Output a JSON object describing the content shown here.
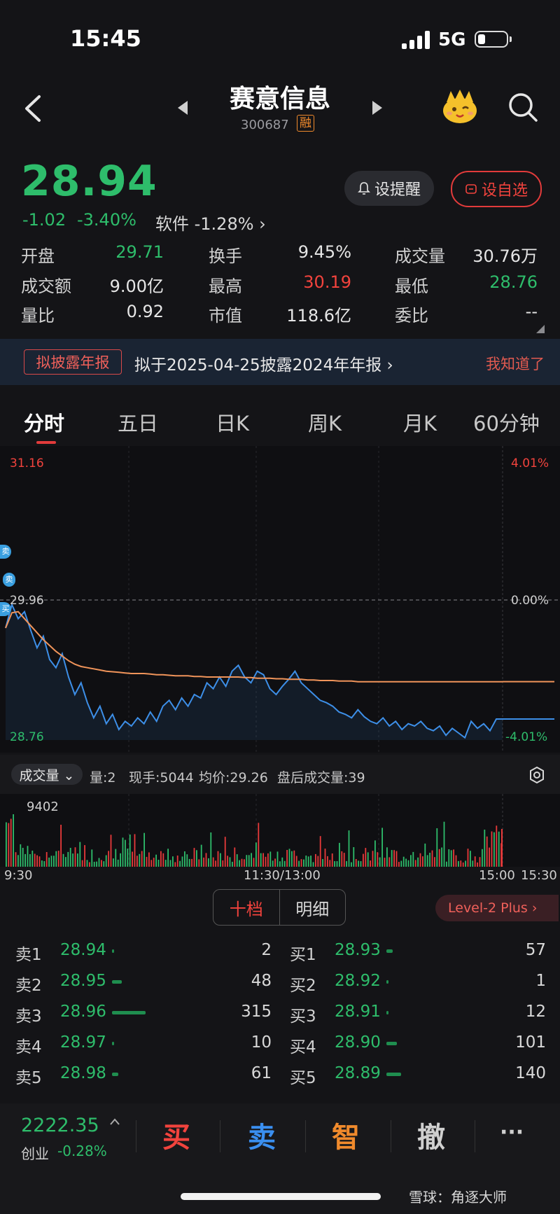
{
  "status_bar": {
    "time": "15:45",
    "network": "5G"
  },
  "header": {
    "title": "赛意信息",
    "code": "300687",
    "margin_badge": "融"
  },
  "quote": {
    "price": "28.94",
    "change": "-1.02",
    "change_pct": "-3.40%",
    "sector": "软件 -1.28%  ›",
    "remind_label": "设提醒",
    "watch_label": "设自选",
    "stats": [
      {
        "label": "开盘",
        "value": "29.71",
        "color": "green"
      },
      {
        "label": "换手",
        "value": "9.45%",
        "color": "white"
      },
      {
        "label": "成交量",
        "value": "30.76万",
        "color": "white"
      },
      {
        "label": "成交额",
        "value": "9.00亿",
        "color": "white"
      },
      {
        "label": "最高",
        "value": "30.19",
        "color": "red"
      },
      {
        "label": "最低",
        "value": "28.76",
        "color": "green"
      },
      {
        "label": "量比",
        "value": "0.92",
        "color": "white"
      },
      {
        "label": "市值",
        "value": "118.6亿",
        "color": "white"
      },
      {
        "label": "委比",
        "value": "--",
        "color": "white"
      }
    ]
  },
  "banner": {
    "tag": "拟披露年报",
    "text": "拟于2025-04-25披露2024年年报  ›",
    "dismiss": "我知道了"
  },
  "tabs": [
    {
      "label": "分时",
      "active": true
    },
    {
      "label": "五日"
    },
    {
      "label": "日K"
    },
    {
      "label": "周K"
    },
    {
      "label": "月K"
    },
    {
      "label": "60分钟 ⌄"
    }
  ],
  "chart": {
    "y_high": "31.16",
    "y_mid": "29.96",
    "y_low": "28.76",
    "pct_high": "4.01%",
    "pct_mid": "0.00%",
    "pct_low": "-4.01%",
    "markers": [
      "卖",
      "卖",
      "买"
    ],
    "colors": {
      "price": "#3d8fe8",
      "avg": "#f0945a",
      "up": "#e83a3a",
      "down": "#2ebd6b"
    }
  },
  "chart_data": {
    "type": "line",
    "ylim": [
      28.76,
      31.16
    ],
    "series": [
      {
        "values": [
          29.72,
          29.92,
          29.8,
          29.86,
          29.7,
          29.55,
          29.65,
          29.45,
          29.38,
          29.5,
          29.3,
          29.15,
          29.25,
          29.08,
          28.95,
          29.05,
          28.9,
          28.98,
          28.85,
          28.92,
          28.88,
          28.95,
          28.9,
          29.0,
          28.92,
          29.05,
          29.1,
          29.02,
          29.12,
          29.05,
          29.15,
          29.12,
          29.25,
          29.2,
          29.3,
          29.22,
          29.35,
          29.4,
          29.3,
          29.25,
          29.35,
          29.32,
          29.2,
          29.15,
          29.22,
          29.28,
          29.35,
          29.25,
          29.2,
          29.15,
          29.1,
          29.08,
          29.05,
          29.0,
          28.98,
          28.95,
          29.02,
          28.96,
          28.92,
          28.9,
          28.95,
          28.88,
          28.92,
          28.85,
          28.9,
          28.88,
          28.92,
          28.86,
          28.84,
          28.88,
          28.8,
          28.86,
          28.82,
          28.78,
          28.92,
          28.86,
          28.9,
          28.84,
          28.94,
          28.94
        ]
      },
      {
        "values": [
          29.72,
          29.85,
          29.86,
          29.8,
          29.74,
          29.68,
          29.62,
          29.57,
          29.52,
          29.48,
          29.44,
          29.41,
          29.39,
          29.38,
          29.37,
          29.36,
          29.35,
          29.345,
          29.34,
          29.335,
          29.33,
          29.33,
          29.33,
          29.325,
          29.32,
          29.32,
          29.315,
          29.31,
          29.31,
          29.31,
          29.305,
          29.305,
          29.3,
          29.3,
          29.3,
          29.3,
          29.3,
          29.3,
          29.295,
          29.295,
          29.29,
          29.29,
          29.29,
          29.285,
          29.285,
          29.28,
          29.28,
          29.28,
          29.275,
          29.275,
          29.27,
          29.27,
          29.27,
          29.265,
          29.265,
          29.265,
          29.26,
          29.26,
          29.26,
          29.26,
          29.26,
          29.26,
          29.26,
          29.26,
          29.26,
          29.26,
          29.26,
          29.26,
          29.26,
          29.26,
          29.26,
          29.26,
          29.26,
          29.26,
          29.26,
          29.26,
          29.26,
          29.26,
          29.26,
          29.26
        ]
      }
    ],
    "volume_max_label": "9402"
  },
  "volume_bar": {
    "selector": "成交量 ⌄",
    "vol": "量:2",
    "now_hand": "现手:5044",
    "avg_price": "均价:29.26",
    "after_hours": "盘后成交量:39"
  },
  "time_axis": [
    "9:30",
    "11:30/13:00",
    "15:00",
    "15:30"
  ],
  "orderbook": {
    "seg_a": "十档",
    "seg_b": "明细",
    "level2": "Level-2 Plus  ›",
    "sell": [
      {
        "label": "卖1",
        "price": "28.94",
        "qty": "2",
        "bar": 0.01
      },
      {
        "label": "卖2",
        "price": "28.95",
        "qty": "48",
        "bar": 0.13
      },
      {
        "label": "卖3",
        "price": "28.96",
        "qty": "315",
        "bar": 0.44
      },
      {
        "label": "卖4",
        "price": "28.97",
        "qty": "10",
        "bar": 0.02
      },
      {
        "label": "卖5",
        "price": "28.98",
        "qty": "61",
        "bar": 0.08
      }
    ],
    "buy": [
      {
        "label": "买1",
        "price": "28.93",
        "qty": "57",
        "bar": 0.08
      },
      {
        "label": "买2",
        "price": "28.92",
        "qty": "1",
        "bar": 0.01
      },
      {
        "label": "买3",
        "price": "28.91",
        "qty": "12",
        "bar": 0.02
      },
      {
        "label": "买4",
        "price": "28.90",
        "qty": "101",
        "bar": 0.14
      },
      {
        "label": "买5",
        "price": "28.89",
        "qty": "140",
        "bar": 0.19
      }
    ]
  },
  "bottom": {
    "index_value": "2222.35",
    "index_name": "创业",
    "index_change": "-0.28%",
    "buy": "买",
    "sell": "卖",
    "smart": "智",
    "cancel": "撤",
    "more": "···",
    "watermark": "雪球：角逐大师"
  }
}
